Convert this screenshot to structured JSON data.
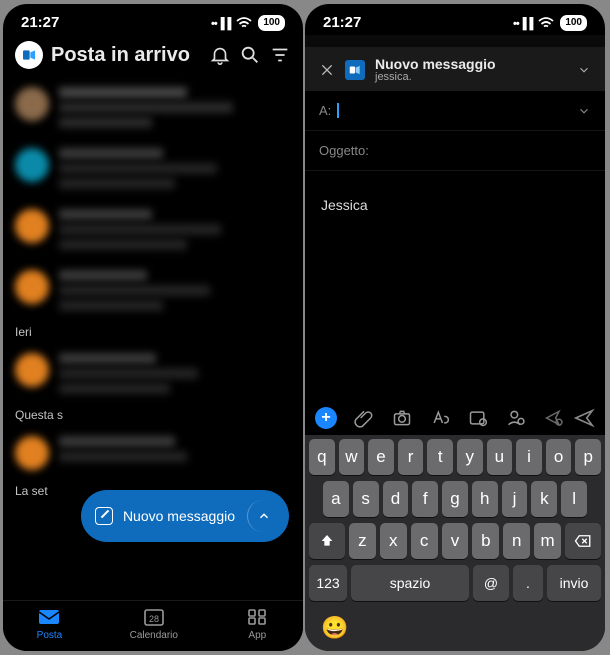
{
  "statusbar": {
    "time": "21:27",
    "battery": "100"
  },
  "inbox": {
    "title": "Posta in arrivo",
    "sections": {
      "yesterday": "Ieri",
      "this": "Questa s",
      "last": "La set"
    },
    "fab_label": "Nuovo messaggio"
  },
  "nav": {
    "mail": "Posta",
    "calendar": "Calendario",
    "calendar_day": "28",
    "apps": "App"
  },
  "compose": {
    "header_title": "Nuovo messaggio",
    "from": "jessica.",
    "to_label": "A:",
    "subject_label": "Oggetto:",
    "signature": "Jessica"
  },
  "keyboard": {
    "row1": [
      "q",
      "w",
      "e",
      "r",
      "t",
      "y",
      "u",
      "i",
      "o",
      "p"
    ],
    "row2": [
      "a",
      "s",
      "d",
      "f",
      "g",
      "h",
      "j",
      "k",
      "l"
    ],
    "row3": [
      "z",
      "x",
      "c",
      "v",
      "b",
      "n",
      "m"
    ],
    "num": "123",
    "space": "spazio",
    "at": "@",
    "dot": ".",
    "enter": "invio"
  }
}
